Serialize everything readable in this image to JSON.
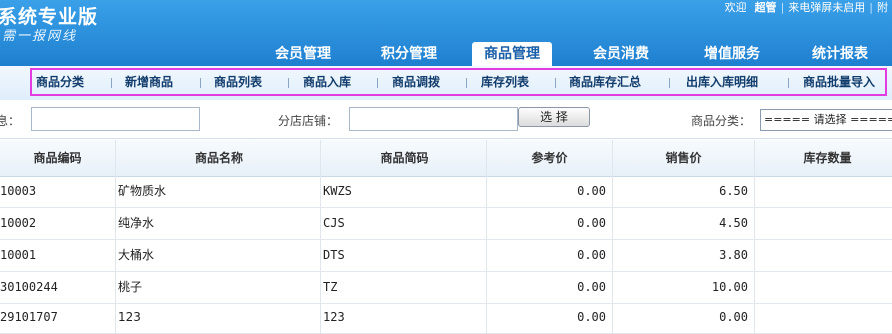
{
  "header": {
    "brand": "系统专业版",
    "slogan": "需一报网线",
    "topbar": {
      "welcome": "欢迎",
      "user": "超管",
      "notice": "来电弹屏未启用",
      "edge": "附"
    },
    "nav": [
      "会员管理",
      "积分管理",
      "商品管理",
      "会员消费",
      "增值服务",
      "统计报表"
    ],
    "active_tab": "商品管理"
  },
  "submenu": [
    "商品分类",
    "新增商品",
    "商品列表",
    "商品入库",
    "商品调拨",
    "库存列表",
    "商品库存汇总",
    "出库入库明细",
    "商品批量导入"
  ],
  "search": {
    "info_label": "息：",
    "info_value": "",
    "store_label": "分店店铺：",
    "store_value": "",
    "select_button": "选 择",
    "category_label": "商品分类：",
    "category_value": "===== 请选择 ====="
  },
  "table": {
    "columns": [
      "商品编码",
      "商品名称",
      "商品简码",
      "参考价",
      "销售价",
      "库存数量"
    ],
    "rows": [
      [
        "10003",
        "矿物质水",
        "KWZS",
        "0.00",
        "6.50",
        ""
      ],
      [
        "10002",
        "纯净水",
        "CJS",
        "0.00",
        "4.50",
        ""
      ],
      [
        "10001",
        "大桶水",
        "DTS",
        "0.00",
        "3.80",
        ""
      ],
      [
        "30100244",
        "桃子",
        "TZ",
        "0.00",
        "10.00",
        ""
      ],
      [
        "29101707",
        "123",
        "123",
        "0.00",
        "0.00",
        ""
      ]
    ]
  }
}
